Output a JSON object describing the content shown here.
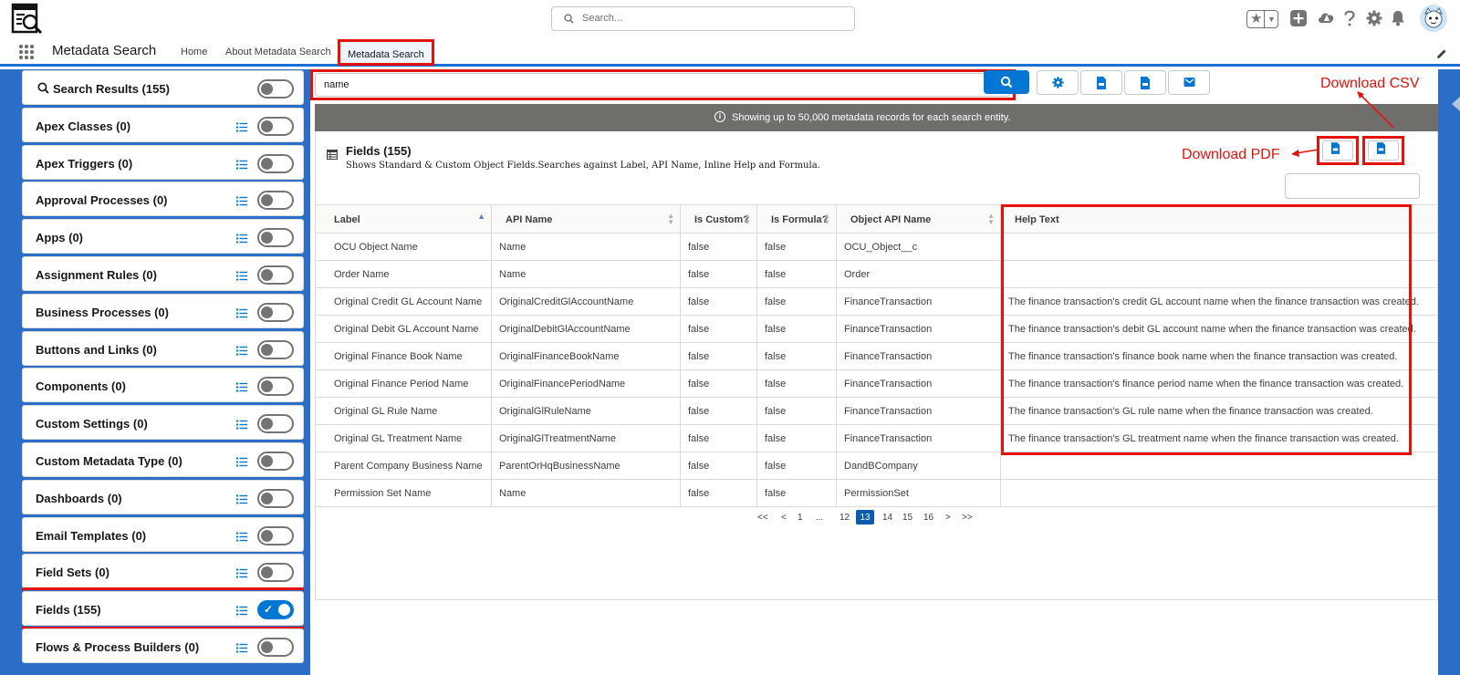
{
  "header": {
    "search_placeholder": "Search..."
  },
  "nav": {
    "app_name": "Metadata Search",
    "tabs": [
      {
        "label": "Home"
      },
      {
        "label": "About Metadata Search"
      },
      {
        "label": "Metadata Search",
        "active": true
      }
    ]
  },
  "sidebar": {
    "items": [
      {
        "label": "Search Results (155)",
        "on": false
      },
      {
        "label": "Apex Classes (0)",
        "on": false
      },
      {
        "label": "Apex Triggers (0)",
        "on": false
      },
      {
        "label": "Approval Processes (0)",
        "on": false
      },
      {
        "label": "Apps (0)",
        "on": false
      },
      {
        "label": "Assignment Rules (0)",
        "on": false
      },
      {
        "label": "Business Processes (0)",
        "on": false
      },
      {
        "label": "Buttons and Links (0)",
        "on": false
      },
      {
        "label": "Components (0)",
        "on": false
      },
      {
        "label": "Custom Settings (0)",
        "on": false
      },
      {
        "label": "Custom Metadata Type (0)",
        "on": false
      },
      {
        "label": "Dashboards (0)",
        "on": false
      },
      {
        "label": "Email Templates (0)",
        "on": false
      },
      {
        "label": "Field Sets (0)",
        "on": false
      },
      {
        "label": "Fields (155)",
        "on": true
      },
      {
        "label": "Flows & Process Builders (0)",
        "on": false
      }
    ]
  },
  "search": {
    "value": "name"
  },
  "banner": {
    "text": "Showing up to 50,000 metadata records for each search entity."
  },
  "card": {
    "title": "Fields (155)",
    "subtitle": "Shows Standard & Custom Object Fields.Searches against Label, API Name, Inline Help and Formula."
  },
  "annotations": {
    "download_csv": "Download CSV",
    "download_pdf": "Download PDF"
  },
  "table": {
    "columns": [
      "Label",
      "API Name",
      "Is Custom?",
      "Is Formula?",
      "Object API Name",
      "Help Text"
    ],
    "rows": [
      [
        "OCU Object Name",
        "Name",
        "false",
        "false",
        "OCU_Object__c",
        ""
      ],
      [
        "Order Name",
        "Name",
        "false",
        "false",
        "Order",
        ""
      ],
      [
        "Original Credit GL Account Name",
        "OriginalCreditGlAccountName",
        "false",
        "false",
        "FinanceTransaction",
        "The finance transaction's credit GL account name when the finance transaction was created."
      ],
      [
        "Original Debit GL Account Name",
        "OriginalDebitGlAccountName",
        "false",
        "false",
        "FinanceTransaction",
        "The finance transaction's debit GL account name when the finance transaction was created."
      ],
      [
        "Original Finance Book Name",
        "OriginalFinanceBookName",
        "false",
        "false",
        "FinanceTransaction",
        "The finance transaction's finance book name when the finance transaction was created."
      ],
      [
        "Original Finance Period Name",
        "OriginalFinancePeriodName",
        "false",
        "false",
        "FinanceTransaction",
        "The finance transaction's finance period name when the finance transaction was created."
      ],
      [
        "Original GL Rule Name",
        "OriginalGlRuleName",
        "false",
        "false",
        "FinanceTransaction",
        "The finance transaction's GL rule name when the finance transaction was created."
      ],
      [
        "Original GL Treatment Name",
        "OriginalGlTreatmentName",
        "false",
        "false",
        "FinanceTransaction",
        "The finance transaction's GL treatment name when the finance transaction was created."
      ],
      [
        "Parent Company Business Name",
        "ParentOrHqBusinessName",
        "false",
        "false",
        "DandBCompany",
        ""
      ],
      [
        "Permission Set Name",
        "Name",
        "false",
        "false",
        "PermissionSet",
        ""
      ]
    ]
  },
  "pager": {
    "items": [
      "<<",
      "<",
      "1",
      "...",
      "12",
      "13",
      "14",
      "15",
      "16",
      ">",
      ">>"
    ],
    "current": "13"
  },
  "colors": {
    "brand": "#0176d3",
    "highlight": "#e3120b",
    "background": "#2a6ec7"
  }
}
